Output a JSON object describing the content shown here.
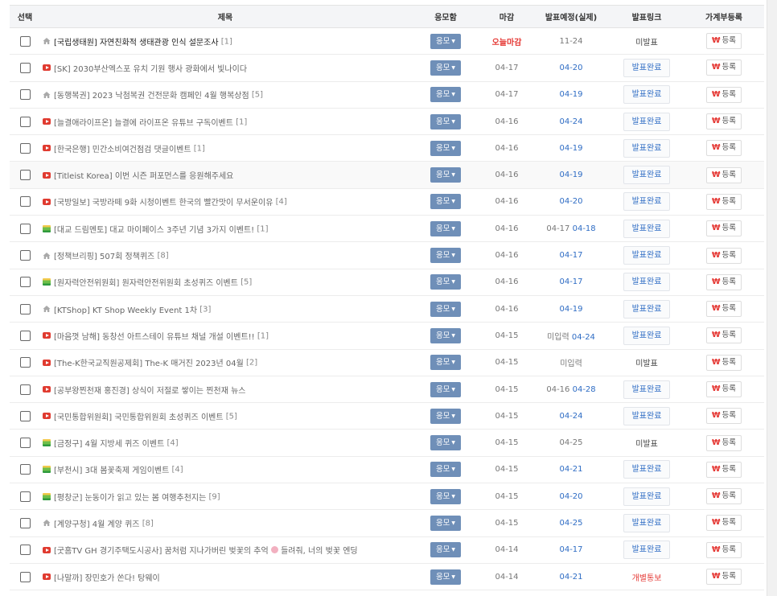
{
  "columns": {
    "select": "선택",
    "title": "제목",
    "apply": "응모함",
    "deadline": "마감",
    "announce": "발표예정(실제)",
    "link": "발표링크",
    "ledger": "가계부등록"
  },
  "apply_label": "응모",
  "ledger_label": "등록",
  "ledger_icon": "₩",
  "colors": {
    "apply_button": "#6f8fb8",
    "today_deadline": "#e53935",
    "announce_link": "#2e6cc4"
  },
  "rows": [
    {
      "icon": "home-icon",
      "title": "[국립생태원] 자연친화적 생태관광 인식 설문조사",
      "count": "[1]",
      "deadline": "오늘마감",
      "announce_plan": "",
      "announce_actual": "11-24",
      "link": "미발표",
      "bold": true
    },
    {
      "icon": "youtube-icon",
      "title": "[SK] 2030부산엑스포 유치 기원 행사 광화에서 빛나이다",
      "count": "",
      "deadline": "04-17",
      "announce_plan": "",
      "announce_actual": "04-20",
      "link": "발표완료"
    },
    {
      "icon": "home-icon",
      "title": "[동행복권] 2023 낙첨복권 건전문화 캠페인 4월 행복상점",
      "count": "[5]",
      "deadline": "04-17",
      "announce_plan": "",
      "announce_actual": "04-19",
      "link": "발표완료"
    },
    {
      "icon": "youtube-icon",
      "title": "[늘결애라이프온] 늘결에 라이프온 유튜브 구독이벤트",
      "count": "[1]",
      "deadline": "04-16",
      "announce_plan": "",
      "announce_actual": "04-24",
      "link": "발표완료"
    },
    {
      "icon": "youtube-icon",
      "title": "[한국은행] 민간소비여건점검 댓글이벤트",
      "count": "[1]",
      "deadline": "04-16",
      "announce_plan": "",
      "announce_actual": "04-19",
      "link": "발표완료"
    },
    {
      "icon": "youtube-icon",
      "title": "[Titleist Korea] 이번 시즌 퍼포먼스를 응원해주세요",
      "count": "",
      "deadline": "04-16",
      "announce_plan": "",
      "announce_actual": "04-19",
      "link": "발표완료"
    },
    {
      "icon": "youtube-icon",
      "title": "[국방일보] 국방라떼 9화 시청이벤트 한국의 빨간맛이 무서운이유",
      "count": "[4]",
      "deadline": "04-16",
      "announce_plan": "",
      "announce_actual": "04-20",
      "link": "발표완료"
    },
    {
      "icon": "web-icon",
      "title": "[대교 드림멘토] 대교 마이페이스 3주년 기념 3가지 이벤트!",
      "count": "[1]",
      "deadline": "04-16",
      "announce_plan": "04-17",
      "announce_actual": "04-18",
      "link": "발표완료"
    },
    {
      "icon": "home-icon",
      "title": "[정책브리핑] 507회 정책퀴즈",
      "count": "[8]",
      "deadline": "04-16",
      "announce_plan": "",
      "announce_actual": "04-17",
      "link": "발표완료"
    },
    {
      "icon": "web-icon",
      "title": "[원자력안전위원회] 원자력안전위원회 초성퀴즈 이벤트",
      "count": "[5]",
      "deadline": "04-16",
      "announce_plan": "",
      "announce_actual": "04-17",
      "link": "발표완료"
    },
    {
      "icon": "home-icon",
      "title": "[KTShop] KT Shop Weekly Event 1차",
      "count": "[3]",
      "deadline": "04-16",
      "announce_plan": "",
      "announce_actual": "04-19",
      "link": "발표완료"
    },
    {
      "icon": "youtube-icon",
      "title": "[마음껏 남해] 동창선 아트스테이 유튜브 채널 개설 이벤트!!",
      "count": "[1]",
      "deadline": "04-15",
      "announce_plan": "미입력",
      "announce_actual": "04-24",
      "link": "발표완료"
    },
    {
      "icon": "youtube-icon",
      "title": "[The-K한국교직원공제회] The-K 매거진 2023년 04월",
      "count": "[2]",
      "deadline": "04-15",
      "announce_plan": "미입력",
      "announce_actual": "",
      "link": "미발표"
    },
    {
      "icon": "youtube-icon",
      "title": "[공부왕찐천재 홍진경] 상식이 저절로 쌓이는 찐천재 뉴스",
      "count": "",
      "deadline": "04-15",
      "announce_plan": "04-16",
      "announce_actual": "04-28",
      "link": "발표완료"
    },
    {
      "icon": "youtube-icon",
      "title": "[국민통합위원회] 국민통합위원회 초성퀴즈 이벤트",
      "count": "[5]",
      "deadline": "04-15",
      "announce_plan": "",
      "announce_actual": "04-24",
      "link": "발표완료"
    },
    {
      "icon": "web-icon",
      "title": "[금정구] 4월 지방세 퀴즈 이벤트",
      "count": "[4]",
      "deadline": "04-15",
      "announce_plan": "04-25",
      "announce_actual": "",
      "link": "미발표"
    },
    {
      "icon": "web-icon",
      "title": "[부천시] 3대 봄꽃축제 게임이벤트",
      "count": "[4]",
      "deadline": "04-15",
      "announce_plan": "",
      "announce_actual": "04-21",
      "link": "발표완료"
    },
    {
      "icon": "web-icon",
      "title": "[평창군] 눈동이가 읽고 있는 봄 여행추천지는",
      "count": "[9]",
      "deadline": "04-15",
      "announce_plan": "",
      "announce_actual": "04-20",
      "link": "발표완료"
    },
    {
      "icon": "home-icon",
      "title": "[계양구청] 4월 계양 퀴즈",
      "count": "[8]",
      "deadline": "04-15",
      "announce_plan": "",
      "announce_actual": "04-25",
      "link": "발표완료"
    },
    {
      "icon": "youtube-icon",
      "title": "[굿홈TV GH 경기주택도시공사] 꿈처럼 지나가버린 벚꽃의 추억",
      "title_after": "들려줘, 너의 벚꽃 엔딩",
      "flower": true,
      "count": "",
      "deadline": "04-14",
      "announce_plan": "",
      "announce_actual": "04-17",
      "link": "발표완료"
    },
    {
      "icon": "youtube-icon",
      "title": "[나말까] 장민호가 쏜다! 탕웨이",
      "count": "",
      "deadline": "04-14",
      "announce_plan": "",
      "announce_actual": "04-21",
      "link": "개별통보"
    }
  ]
}
